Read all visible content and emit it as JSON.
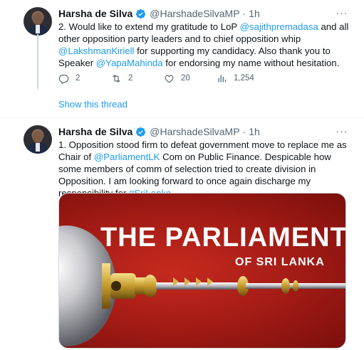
{
  "tweets": [
    {
      "author_name": "Harsha de Silva",
      "handle": "@HarshadeSilvaMP",
      "separator": "·",
      "time": "1h",
      "more": "···",
      "text_segments": [
        {
          "text": "2. Would like to extend my gratitude to LoP ",
          "link": false
        },
        {
          "text": "@sajithpremadasa",
          "link": true
        },
        {
          "text": " and all other opposition party leaders and to chief opposition whip ",
          "link": false
        },
        {
          "text": "@LakshmanKiriell",
          "link": true
        },
        {
          "text": " for supporting my candidacy. Also thank you to Speaker ",
          "link": false
        },
        {
          "text": "@YapaMahinda",
          "link": true
        },
        {
          "text": " for endorsing my name without hesitation.",
          "link": false
        }
      ],
      "replies": "2",
      "retweets": "2",
      "likes": "20",
      "views": "1,254"
    },
    {
      "author_name": "Harsha de Silva",
      "handle": "@HarshadeSilvaMP",
      "separator": "·",
      "time": "1h",
      "more": "···",
      "text_segments": [
        {
          "text": "1. Opposition stood firm to defeat government move to replace me as Chair of ",
          "link": false
        },
        {
          "text": "@ParliamentLK",
          "link": true
        },
        {
          "text": " Com on Public Finance. Despicable how some members of comm of selection tried to create division in Opposition. I am looking forward to once again discharge my responsibility for ",
          "link": false
        },
        {
          "text": "#SriLanka",
          "link": true
        }
      ],
      "media_title": "THE PARLIAMENT",
      "media_subtitle": "OF SRI LANKA"
    }
  ],
  "show_thread": "Show this thread",
  "colors": {
    "link": "#1d9bf0",
    "verified": "#1d9bf0",
    "muted": "#536471",
    "media_red": "#b3221a"
  },
  "icons": [
    "verified-badge-icon",
    "more-icon",
    "reply-icon",
    "retweet-icon",
    "like-icon",
    "views-icon"
  ]
}
